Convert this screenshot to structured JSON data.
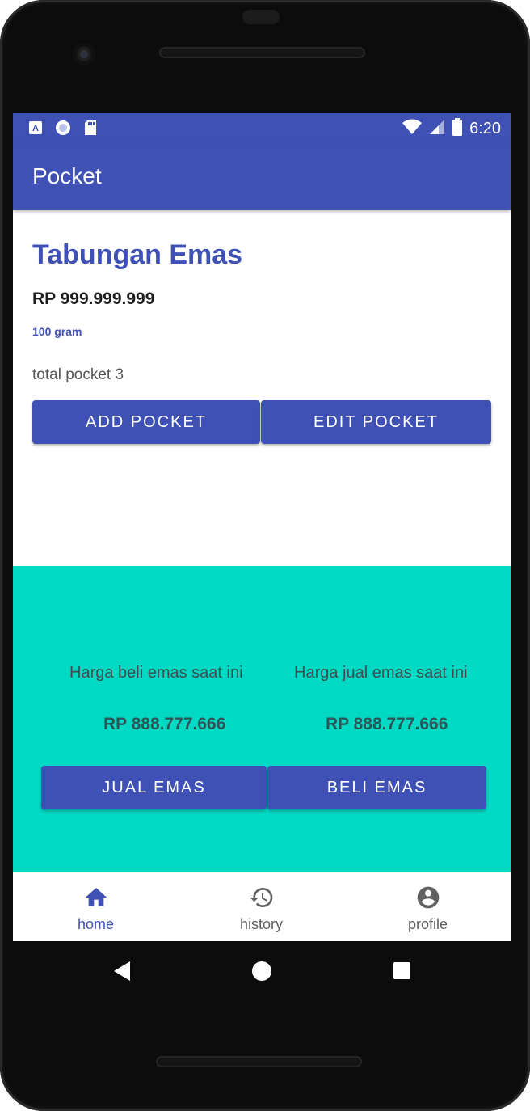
{
  "status_bar": {
    "time": "6:20"
  },
  "app_bar": {
    "title": "Pocket"
  },
  "savings": {
    "title": "Tabungan Emas",
    "balance": "RP 999.999.999",
    "grams": "100 gram",
    "total_pocket": "total pocket 3",
    "add_pocket_label": "ADD POCKET",
    "edit_pocket_label": "EDIT POCKET"
  },
  "gold_prices": {
    "buy_label": "Harga beli emas saat ini",
    "buy_value": "RP 888.777.666",
    "sell_label": "Harga jual emas saat ini",
    "sell_value": "RP 888.777.666",
    "sell_gold_label": "JUAL EMAS",
    "buy_gold_label": "BELI EMAS"
  },
  "bottom_nav": {
    "items": [
      {
        "label": "home",
        "icon": "home-icon",
        "active": true
      },
      {
        "label": "history",
        "icon": "history-icon",
        "active": false
      },
      {
        "label": "profile",
        "icon": "profile-icon",
        "active": false
      }
    ]
  },
  "colors": {
    "primary": "#3f51b5",
    "accent_background": "#00d9c4"
  }
}
